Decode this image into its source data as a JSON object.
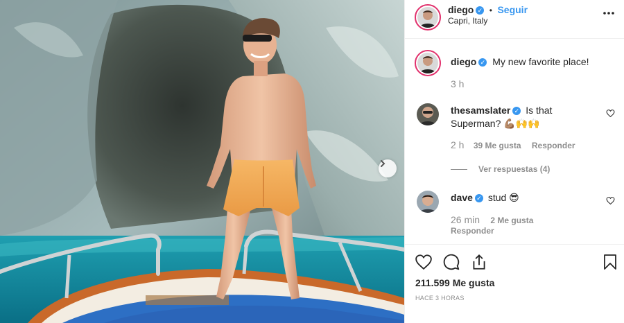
{
  "post": {
    "username": "diego",
    "follow_label": "Seguir",
    "separator": "•",
    "location": "Capri, Italy",
    "more_icon": "more-horizontal-icon"
  },
  "caption": {
    "username": "diego",
    "text": "My new favorite place!",
    "time": "3 h"
  },
  "comments": [
    {
      "username": "thesamslater",
      "text_line1": "Is that",
      "text_line2": "Superman? 💪🏽🙌🙌",
      "time": "2 h",
      "likes": "39 Me gusta",
      "reply_label": "Responder",
      "view_replies": "Ver respuestas (4)"
    },
    {
      "username": "dave",
      "text": "stud 😎",
      "time": "26 min",
      "likes": "2 Me gusta",
      "reply_label": "Responder"
    }
  ],
  "stats": {
    "likes": "211.599 Me gusta",
    "posted": "HACE 3 HORAS"
  },
  "colors": {
    "accent": "#3897f0",
    "text": "#262626",
    "muted": "#8e8e8e",
    "border": "#efefef"
  }
}
